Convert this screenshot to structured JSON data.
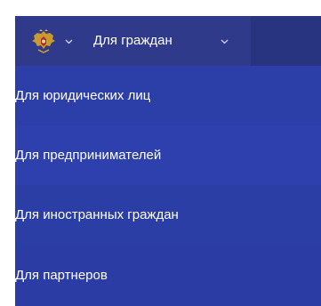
{
  "header": {
    "emblem_icon": "coat-of-arms-icon",
    "emblem_menu_icon": "chevron-down-icon",
    "audience_label": "Для граждан",
    "audience_menu_icon": "chevron-down-icon"
  },
  "menu": {
    "items": [
      {
        "label": "Для юридических лиц"
      },
      {
        "label": "Для предпринимателей"
      },
      {
        "label": "Для иностранных граждан"
      },
      {
        "label": "Для партнеров"
      }
    ]
  },
  "colors": {
    "topbar": "#2f3a8a",
    "menu_background": "#2c3fa9",
    "text": "#ffffff",
    "emblem": "#c99a2e"
  }
}
